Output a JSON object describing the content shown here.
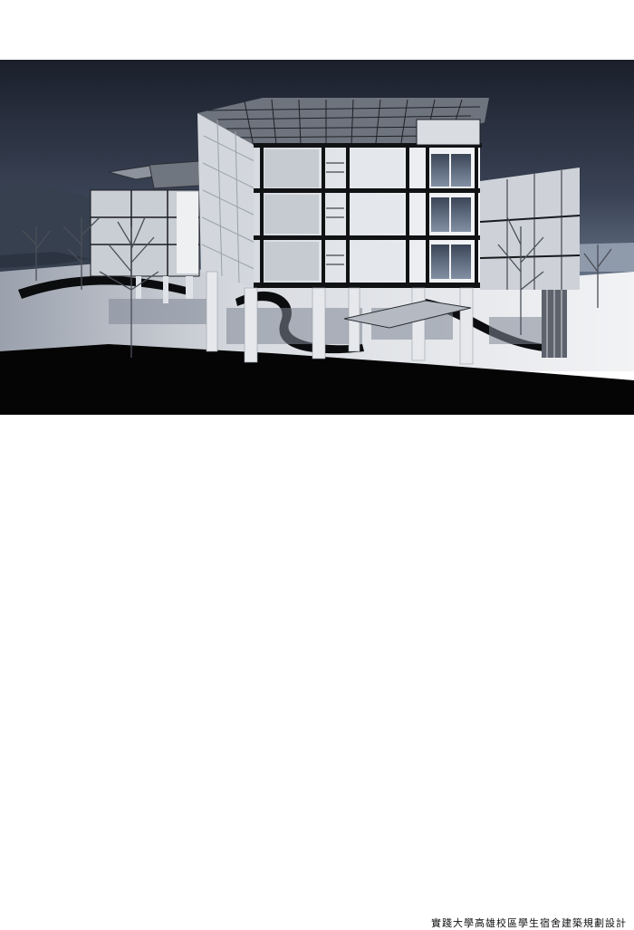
{
  "caption": "實踐大學高雄校區學生宿舍建築規劃設計",
  "colors": {
    "sky_top": "#1c2230",
    "sky_bottom": "#5d6b80",
    "ground": "#e8e9ec",
    "base": "#050505",
    "frame": "#101214",
    "panel_light": "#e9ebee",
    "panel_mid": "#b9bec6"
  }
}
